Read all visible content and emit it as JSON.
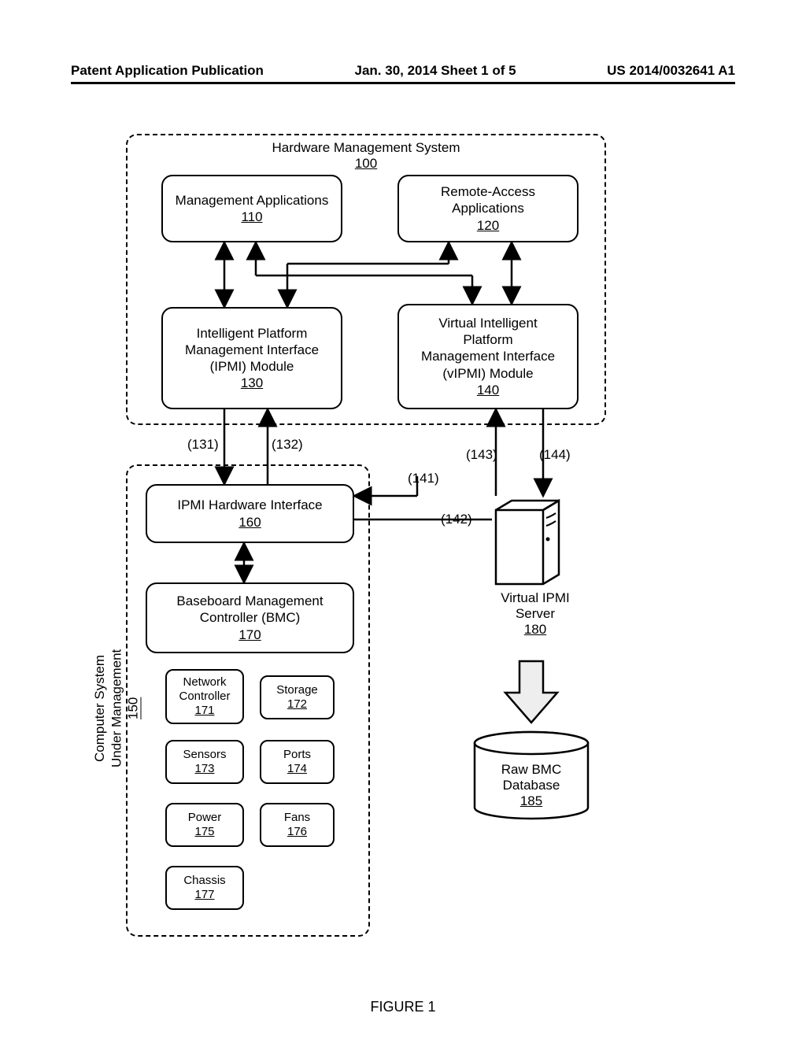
{
  "header": {
    "left": "Patent Application Publication",
    "center": "Jan. 30, 2014  Sheet 1 of 5",
    "right": "US 2014/0032641 A1"
  },
  "figure_caption": "FIGURE 1",
  "hms": {
    "title": "Hardware Management System",
    "ref": "100"
  },
  "mgmt_apps": {
    "title": "Management Applications",
    "ref": "110"
  },
  "remote_apps": {
    "title": "Remote-Access Applications",
    "ref": "120"
  },
  "ipmi_mod": {
    "l1": "Intelligent Platform",
    "l2": "Management Interface",
    "l3": "(IPMI) Module",
    "ref": "130"
  },
  "vipmi_mod": {
    "l1": "Virtual Intelligent",
    "l2": "Platform",
    "l3": "Management Interface",
    "l4": "(vIPMI) Module",
    "ref": "140"
  },
  "conn": {
    "c131": "(131)",
    "c132": "(132)",
    "c141": "(141)",
    "c142": "(142)",
    "c143": "(143)",
    "c144": "(144)"
  },
  "csum": {
    "title_l1": "Computer System",
    "title_l2": "Under Management",
    "ref": "150"
  },
  "ipmi_hw": {
    "title": "IPMI Hardware Interface",
    "ref": "160"
  },
  "bmc": {
    "l1": "Baseboard Management",
    "l2": "Controller (BMC)",
    "ref": "170"
  },
  "net": {
    "l1": "Network",
    "l2": "Controller",
    "ref": "171"
  },
  "storage": {
    "title": "Storage",
    "ref": "172"
  },
  "sensors": {
    "title": "Sensors",
    "ref": "173"
  },
  "ports": {
    "title": "Ports",
    "ref": "174"
  },
  "power": {
    "title": "Power",
    "ref": "175"
  },
  "fans": {
    "title": "Fans",
    "ref": "176"
  },
  "chassis": {
    "title": "Chassis",
    "ref": "177"
  },
  "vipmi_server": {
    "l1": "Virtual IPMI",
    "l2": "Server",
    "ref": "180"
  },
  "rawbmc": {
    "l1": "Raw BMC",
    "l2": "Database",
    "ref": "185"
  }
}
